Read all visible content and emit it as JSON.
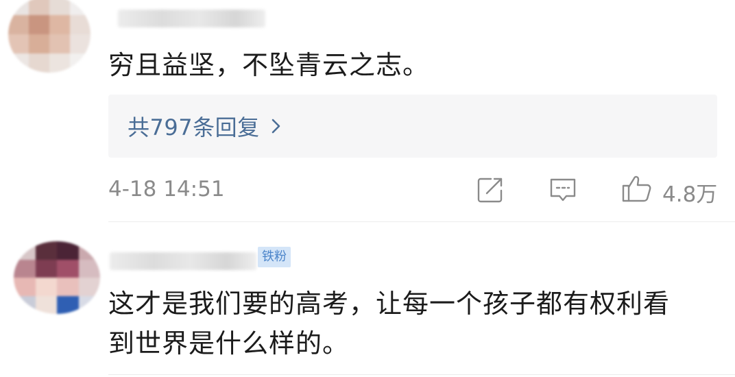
{
  "comments": [
    {
      "text": "穷且益坚，不坠青云之志。",
      "replies_label": "共797条回复",
      "timestamp": "4-18 14:51",
      "like_count": "4.8万"
    },
    {
      "badge": "铁粉",
      "text": "这才是我们要的高考，让每一个孩子都有权利看\n到世界是什么样的。"
    }
  ],
  "icons": {
    "replies_chevron": "chevron-right-icon",
    "share": "share-icon",
    "reply": "comment-icon",
    "like": "thumbs-up-icon"
  },
  "colors": {
    "link": "#4a6d96",
    "meta": "#8a8a8a",
    "badge_bg": "#d4e5f8",
    "badge_text": "#4b84c9",
    "reply_box_bg": "#f6f6f7"
  }
}
